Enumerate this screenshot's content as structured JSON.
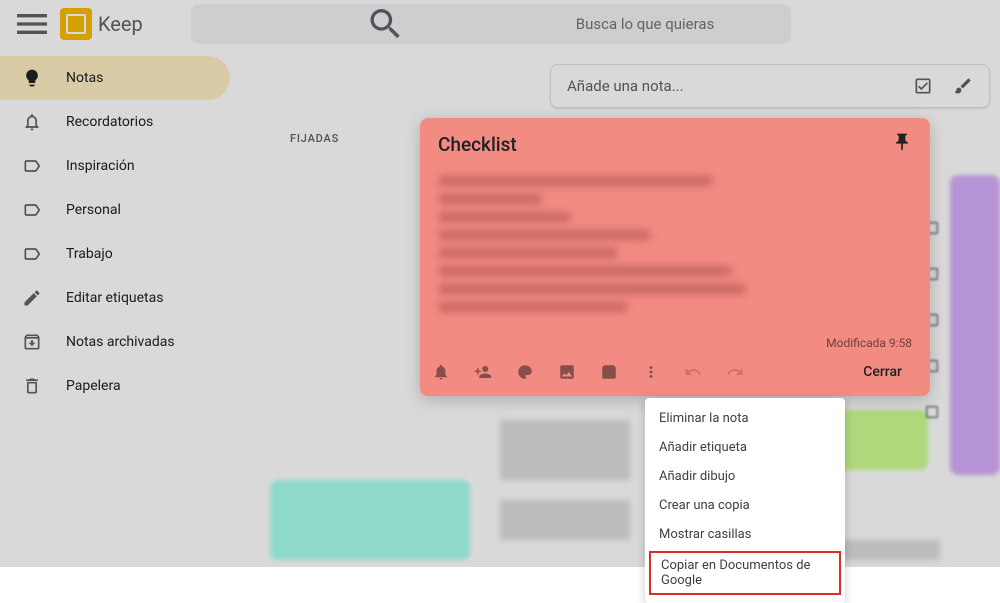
{
  "header": {
    "app_name": "Keep",
    "search_placeholder": "Busca lo que quieras"
  },
  "sidebar": {
    "items": [
      {
        "label": "Notas",
        "icon": "lightbulb",
        "active": true
      },
      {
        "label": "Recordatorios",
        "icon": "bell"
      },
      {
        "label": "Inspiración",
        "icon": "label"
      },
      {
        "label": "Personal",
        "icon": "label"
      },
      {
        "label": "Trabajo",
        "icon": "label"
      },
      {
        "label": "Editar etiquetas",
        "icon": "pencil"
      },
      {
        "label": "Notas archivadas",
        "icon": "archive"
      },
      {
        "label": "Papelera",
        "icon": "trash"
      }
    ]
  },
  "take_note": {
    "placeholder": "Añade una nota..."
  },
  "section": {
    "pinned_label": "FIJADAS"
  },
  "note": {
    "title": "Checklist",
    "modified": "Modificada  9:58",
    "close_label": "Cerrar"
  },
  "menu": {
    "items": [
      "Eliminar la nota",
      "Añadir etiqueta",
      "Añadir dibujo",
      "Crear una copia",
      "Mostrar casillas",
      "Copiar en Documentos de Google"
    ],
    "highlighted_index": 5
  }
}
